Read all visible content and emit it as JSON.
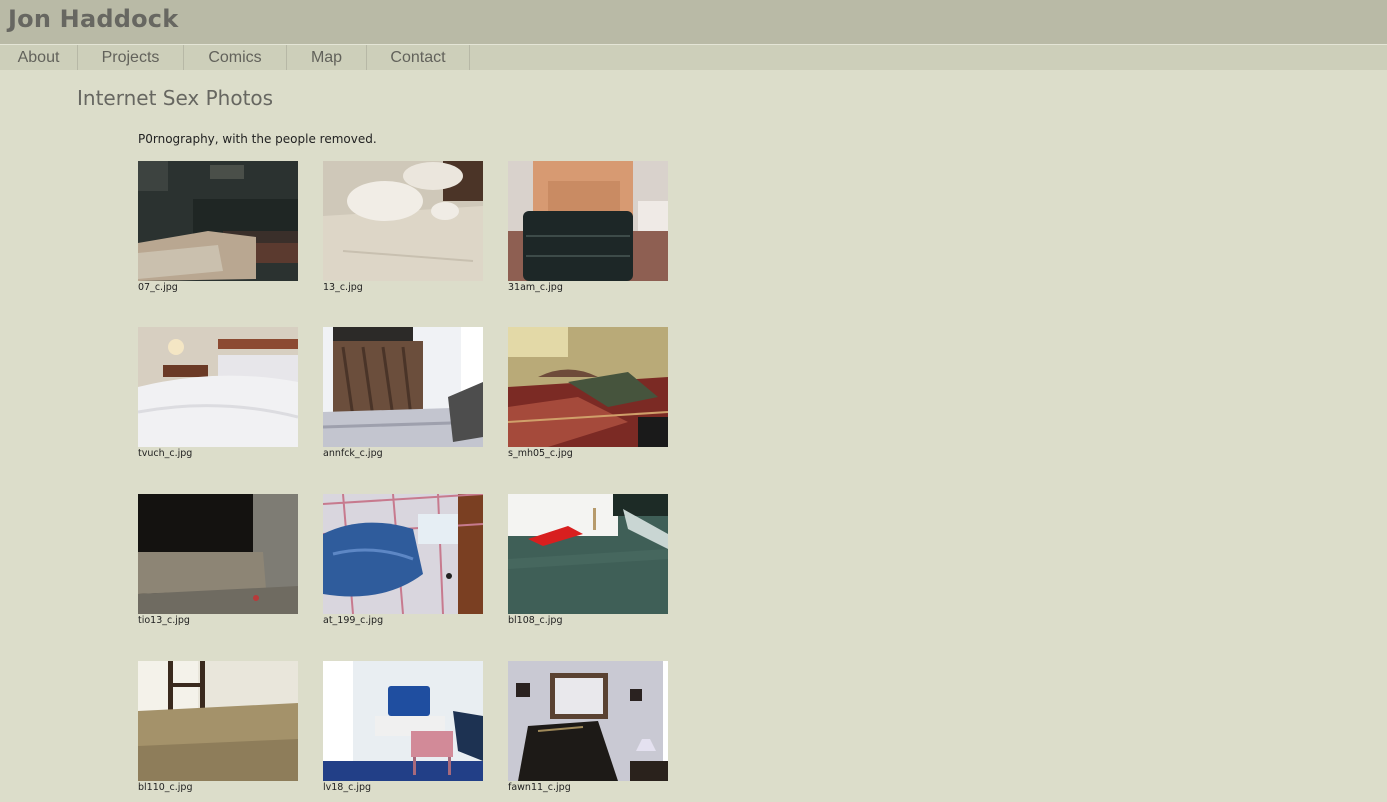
{
  "site": {
    "title": "Jon Haddock"
  },
  "nav": {
    "items": [
      {
        "label": "About",
        "id": "about"
      },
      {
        "label": "Projects",
        "id": "projects"
      },
      {
        "label": "Comics",
        "id": "comics"
      },
      {
        "label": "Map",
        "id": "map"
      },
      {
        "label": "Contact",
        "id": "contact"
      }
    ]
  },
  "page": {
    "title": "Internet Sex Photos",
    "intro": "P0rnography, with the people removed."
  },
  "gallery": {
    "photos": [
      {
        "caption": "07_c.jpg",
        "scene": "dark-bedroom"
      },
      {
        "caption": "13_c.jpg",
        "scene": "white-bed-pillows"
      },
      {
        "caption": "31am_c.jpg",
        "scene": "leather-ottoman"
      },
      {
        "caption": "tvuch_c.jpg",
        "scene": "white-bed-lamp"
      },
      {
        "caption": "annfck_c.jpg",
        "scene": "wardrobe-bed"
      },
      {
        "caption": "s_mh05_c.jpg",
        "scene": "quilt-bed"
      },
      {
        "caption": "tio13_c.jpg",
        "scene": "stone-bench-night"
      },
      {
        "caption": "at_199_c.jpg",
        "scene": "blue-satin-bed"
      },
      {
        "caption": "bl108_c.jpg",
        "scene": "green-carpet-red-cloth"
      },
      {
        "caption": "bl110_c.jpg",
        "scene": "carpet-chair"
      },
      {
        "caption": "lv18_c.jpg",
        "scene": "suitcase-stool"
      },
      {
        "caption": "fawn11_c.jpg",
        "scene": "dark-room-mirror"
      }
    ]
  }
}
